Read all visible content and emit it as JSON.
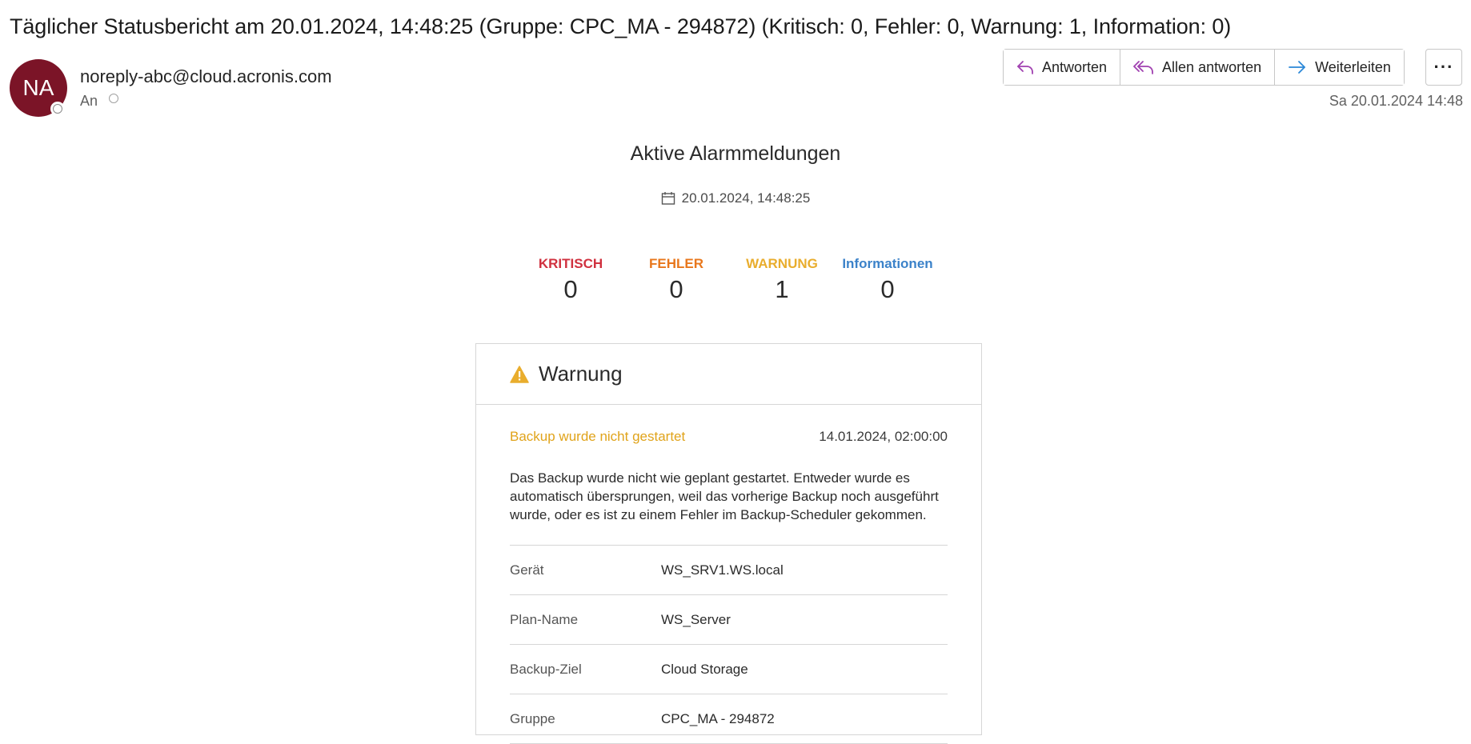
{
  "email": {
    "subject": "Täglicher Statusbericht am 20.01.2024, 14:48:25 (Gruppe: CPC_MA - 294872) (Kritisch: 0, Fehler: 0, Warnung: 1, Information: 0)",
    "avatar_initials": "NA",
    "sender": "noreply-abc@cloud.acronis.com",
    "to_label": "An",
    "date": "Sa 20.01.2024 14:48"
  },
  "actions": {
    "reply": "Antworten",
    "reply_all": "Allen antworten",
    "forward": "Weiterleiten",
    "more": "···"
  },
  "report": {
    "title": "Aktive Alarmmeldungen",
    "timestamp": "20.01.2024, 14:48:25",
    "stats": [
      {
        "label": "KRITISCH",
        "value": "0",
        "color": "#d0313f"
      },
      {
        "label": "FEHLER",
        "value": "0",
        "color": "#e8771c"
      },
      {
        "label": "WARNUNG",
        "value": "1",
        "color": "#e9ad2d"
      },
      {
        "label": "Informationen",
        "value": "0",
        "color": "#3b82c9"
      }
    ]
  },
  "card": {
    "heading": "Warnung",
    "alert_name": "Backup wurde nicht gestartet",
    "alert_time": "14.01.2024, 02:00:00",
    "description": "Das Backup wurde nicht wie geplant gestartet. Entweder wurde es automatisch übersprungen, weil das vorherige Backup noch ausgeführt wurde, oder es ist zu einem Fehler im Backup-Scheduler gekommen.",
    "details": [
      {
        "key": "Gerät",
        "value": "WS_SRV1.WS.local"
      },
      {
        "key": "Plan-Name",
        "value": "WS_Server"
      },
      {
        "key": "Backup-Ziel",
        "value": "Cloud Storage"
      },
      {
        "key": "Gruppe",
        "value": "CPC_MA - 294872"
      }
    ]
  },
  "colors": {
    "avatar_bg": "#7b1427",
    "warning": "#e9ad2d",
    "accent_reply": "#a040b0",
    "accent_forward": "#2b88d8"
  }
}
